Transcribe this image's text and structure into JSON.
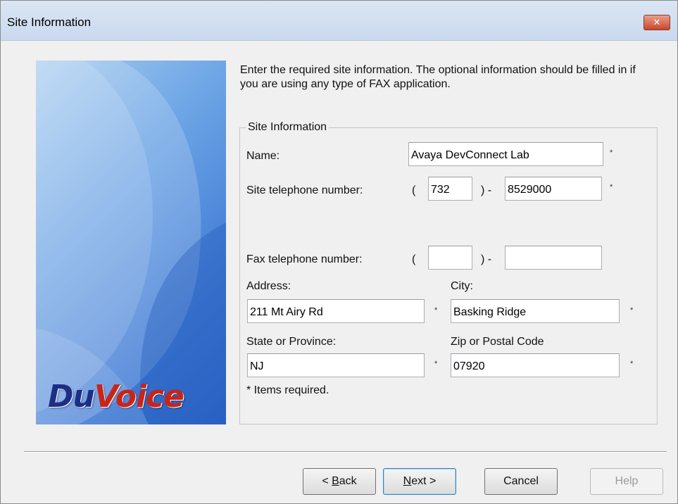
{
  "window": {
    "title": "Site Information",
    "close_glyph": "✕"
  },
  "banner": {
    "logo_du": "Du",
    "logo_voice": "Voice"
  },
  "intro_text": "Enter the required site information.  The optional information should be filled in if you are using any type of FAX application.",
  "group": {
    "legend": "Site Information",
    "name_label": "Name:",
    "name_value": "Avaya DevConnect Lab",
    "site_phone_label": "Site telephone number:",
    "site_area_code": "732",
    "site_number": "8529000",
    "fax_phone_label": "Fax telephone number:",
    "fax_area_code": "",
    "fax_number": "",
    "paren_open": "(",
    "paren_close_dash": ")  -",
    "address_label": "Address:",
    "address_value": "211 Mt Airy Rd",
    "city_label": "City:",
    "city_value": "Basking Ridge",
    "state_label": "State or Province:",
    "state_value": "NJ",
    "zip_label": "Zip or Postal Code",
    "zip_value": "07920",
    "required_mark": "*",
    "required_note": "* Items required."
  },
  "buttons": {
    "back_prefix": "< ",
    "back_mnemonic": "B",
    "back_rest": "ack",
    "next_mnemonic": "N",
    "next_rest": "ext >",
    "cancel": "Cancel",
    "help": "Help"
  }
}
